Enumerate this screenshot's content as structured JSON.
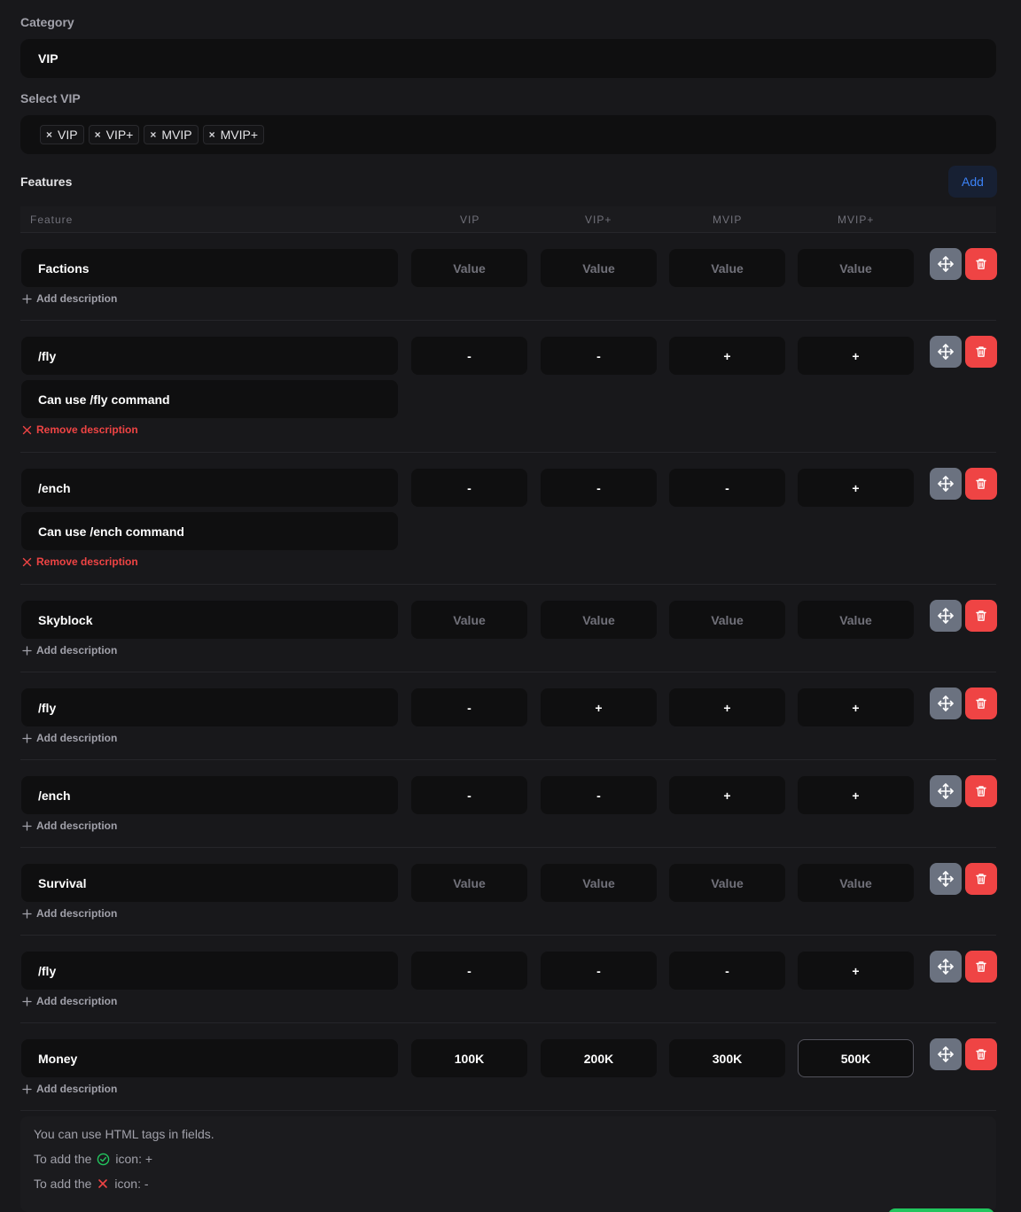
{
  "category": {
    "label": "Category",
    "value": "VIP"
  },
  "select_vip": {
    "label": "Select VIP",
    "tags": [
      "VIP",
      "VIP+",
      "MVIP",
      "MVIP+"
    ],
    "remove_glyph": "×"
  },
  "features": {
    "label": "Features",
    "add_label": "Add",
    "columns": [
      "Feature",
      "VIP",
      "VIP+",
      "MVIP",
      "MVIP+"
    ],
    "placeholder": "Value",
    "add_description_label": "Add description",
    "remove_description_label": "Remove description",
    "rows": [
      {
        "name": "Factions",
        "values": [
          "",
          "",
          "",
          ""
        ],
        "description": null
      },
      {
        "name": "/fly",
        "values": [
          "-",
          "-",
          "+",
          "+"
        ],
        "description": "Can use /fly command"
      },
      {
        "name": "/ench",
        "values": [
          "-",
          "-",
          "-",
          "+"
        ],
        "description": "Can use /ench command"
      },
      {
        "name": "Skyblock",
        "values": [
          "",
          "",
          "",
          ""
        ],
        "description": null
      },
      {
        "name": "/fly",
        "values": [
          "-",
          "+",
          "+",
          "+"
        ],
        "description": null
      },
      {
        "name": "/ench",
        "values": [
          "-",
          "-",
          "+",
          "+"
        ],
        "description": null
      },
      {
        "name": "Survival",
        "values": [
          "",
          "",
          "",
          ""
        ],
        "description": null
      },
      {
        "name": "/fly",
        "values": [
          "-",
          "-",
          "-",
          "+"
        ],
        "description": null
      },
      {
        "name": "Money",
        "values": [
          "100K",
          "200K",
          "300K",
          "500K"
        ],
        "description": null
      }
    ]
  },
  "help": {
    "line1": "You can use HTML tags in fields.",
    "line2_prefix": "To add the",
    "line2_suffix": "icon: +",
    "line3_prefix": "To add the",
    "line3_suffix": "icon: -"
  },
  "icons": {
    "move": "move-icon",
    "delete": "trash-icon",
    "plus": "plus-icon",
    "remove": "x-icon",
    "check": "check-circle-icon",
    "cross": "x-icon"
  },
  "colors": {
    "background": "#18181b",
    "field": "#0f0f10",
    "accent": "#3b82f6",
    "danger": "#ef4444",
    "success": "#22c55e",
    "move": "#6b7280"
  }
}
